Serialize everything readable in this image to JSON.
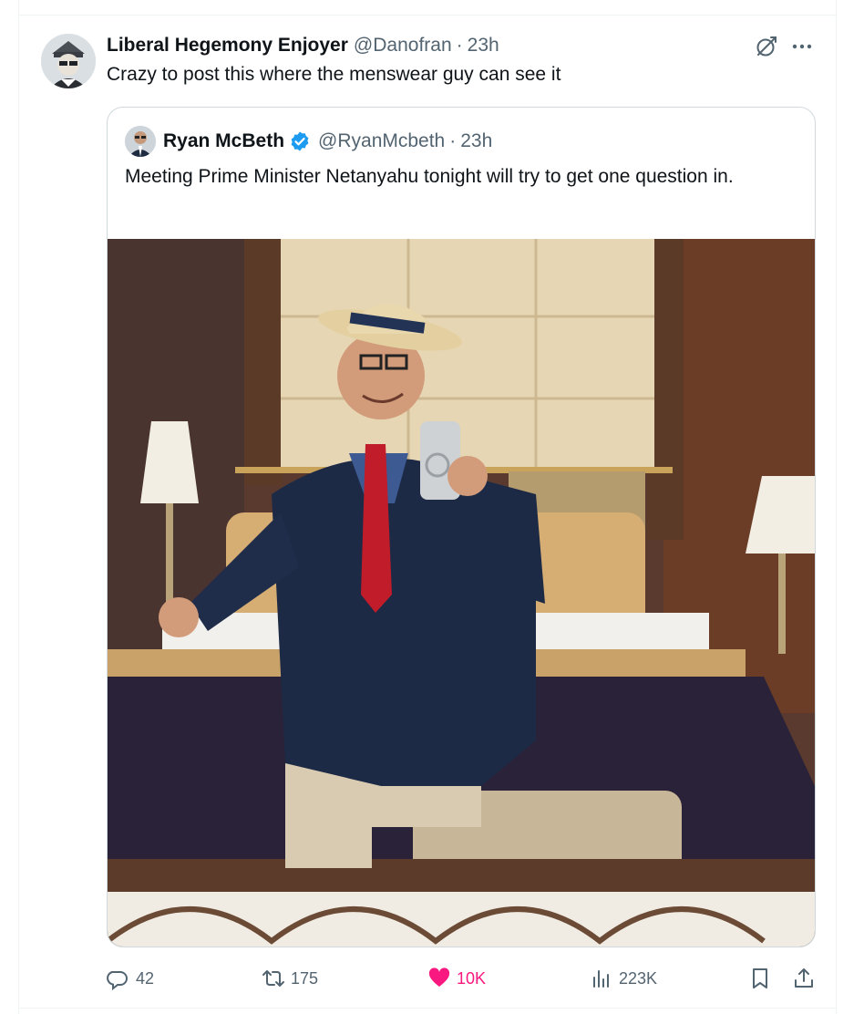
{
  "tweet": {
    "author": {
      "display_name": "Liberal Hegemony Enjoyer",
      "handle": "@Danofran",
      "separator": "·",
      "time": "23h"
    },
    "text": "Crazy to post this where the menswear guy can see it",
    "icons": {
      "grok": "grok-icon",
      "more": "more-icon"
    }
  },
  "quote": {
    "author": {
      "display_name": "Ryan McBeth",
      "verified": true,
      "handle": "@RyanMcbeth",
      "separator": "·",
      "time": "23h"
    },
    "text": "Meeting Prime Minister Netanyahu tonight will try to get one question in.",
    "photo": {
      "icon": "photo"
    }
  },
  "actions": {
    "replies": "42",
    "reposts": "175",
    "likes": "10K",
    "views": "223K",
    "liked": true
  },
  "colors": {
    "like": "#f91880",
    "muted": "#536471",
    "verified": "#1d9bf0",
    "border": "#cfd9de"
  }
}
